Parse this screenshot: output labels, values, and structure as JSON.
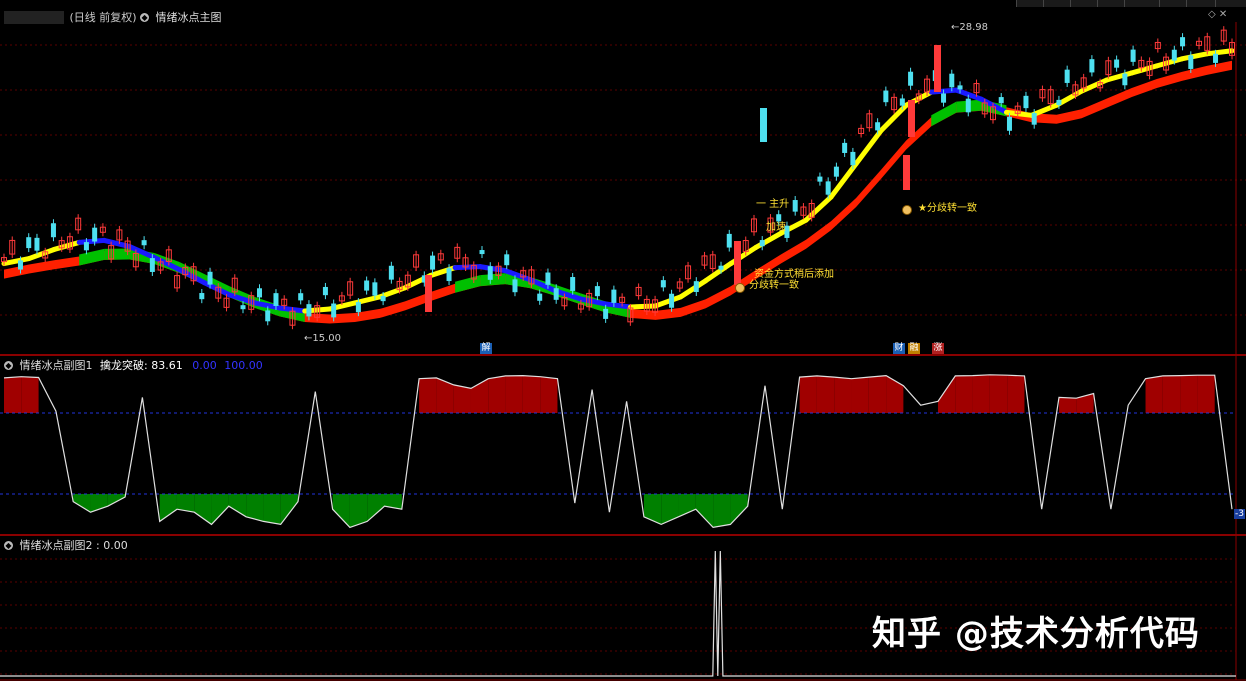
{
  "main_panel": {
    "period_label": "(日线 前复权)",
    "indicator_name": "情绪冰点主图",
    "high_label": "28.98",
    "low_label": "15.00",
    "annotations": [
      "一 主升",
      "加速",
      "资金方式稍后添加",
      "分歧转一致",
      "分歧转一致"
    ],
    "badges": [
      "解",
      "财",
      "融",
      "涨"
    ]
  },
  "sub_panel_1": {
    "name": "情绪冰点副图1",
    "field_label": "擒龙突破:",
    "field_value": "83.61",
    "extra_value_1": "0.00",
    "extra_value_2": "100.00",
    "right_axis_label": "-3"
  },
  "sub_panel_2": {
    "name": "情绪冰点副图2",
    "value": ": 0.00"
  },
  "watermark": "知乎 @技术分析代码",
  "colors": {
    "up": "#ff3a3a",
    "down": "#4ee0f0",
    "yellow": "#ffff00",
    "red_band": "#ff2000",
    "blue_band": "#1a1aff",
    "green_band": "#00c000",
    "fill_red": "#a00000",
    "fill_green": "#008000"
  },
  "chart_data": [
    {
      "type": "line",
      "title": "情绪冰点主图",
      "y_range": [
        15.0,
        28.98
      ],
      "series": [
        {
          "name": "",
          "values": [
            17.4,
            17.9,
            18.3,
            18.6,
            18.5,
            18.0,
            17.4,
            16.8,
            16.1,
            15.6,
            15.3,
            15.1,
            15.0,
            15.3,
            15.6,
            15.9,
            16.5,
            17.1,
            17.3,
            17.2,
            16.9,
            16.3,
            15.8,
            15.5,
            15.3,
            15.2,
            15.4,
            16.1,
            17.0,
            17.8,
            18.6,
            19.2,
            19.9,
            21.5,
            23.2,
            24.8,
            25.7,
            26.1,
            25.9,
            25.2,
            24.6,
            24.9,
            25.6,
            26.3,
            26.7,
            27.0,
            27.4,
            27.7,
            27.9,
            28.0
          ]
        }
      ]
    },
    {
      "type": "area",
      "title": "情绪冰点副图1",
      "y_range": [
        0,
        100
      ],
      "series": [
        {
          "name": "擒龙突破",
          "values": [
            90,
            93,
            91,
            5,
            -5,
            -12,
            -8,
            -2,
            40,
            -18,
            -10,
            -12,
            -20,
            -8,
            -15,
            -18,
            -20,
            -5,
            55,
            -10,
            -22,
            -18,
            -8,
            -10,
            88,
            90,
            72,
            63,
            88,
            95,
            96,
            93,
            88,
            -6,
            60,
            -12,
            30,
            -15,
            -20,
            -15,
            -10,
            -22,
            -20,
            -8,
            70,
            -10,
            92,
            95,
            92,
            88,
            92,
            96,
            70,
            20,
            30,
            95,
            96,
            98,
            97,
            95,
            -10,
            40,
            38,
            50,
            -10,
            20,
            88,
            95,
            96,
            97,
            97,
            -10
          ]
        }
      ]
    },
    {
      "type": "line",
      "title": "情绪冰点副图2",
      "y_range": [
        0,
        1
      ],
      "series": [
        {
          "name": "",
          "values": [
            0,
            0,
            0,
            0,
            0,
            0,
            0,
            0,
            0,
            0,
            0,
            0,
            0,
            0,
            1,
            0,
            1,
            0,
            0,
            0,
            0,
            0,
            0,
            0
          ]
        }
      ]
    }
  ]
}
